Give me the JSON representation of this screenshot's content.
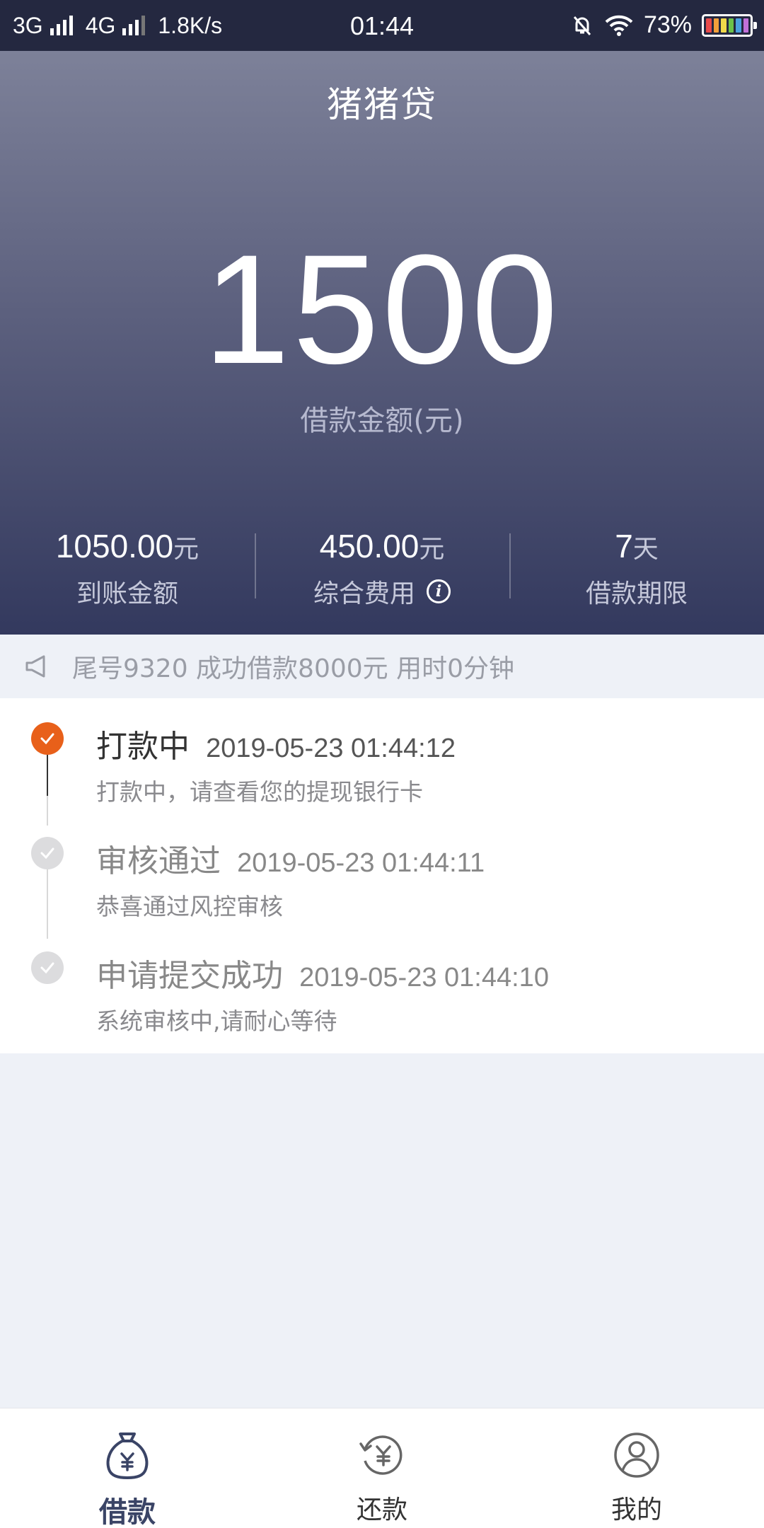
{
  "status_bar": {
    "network1": "3G",
    "network2": "4G",
    "speed": "1.8K/s",
    "time": "01:44",
    "battery": "73%",
    "icons": [
      "signal-icon",
      "mute-bell-icon",
      "wifi-icon",
      "battery-icon"
    ]
  },
  "header": {
    "app_title": "猪猪贷",
    "amount": "1500",
    "amount_label": "借款金额(元)"
  },
  "stats": [
    {
      "value": "1050.00",
      "unit": "元",
      "label": "到账金额"
    },
    {
      "value": "450.00",
      "unit": "元",
      "label": "综合费用",
      "icon": "info-icon"
    },
    {
      "value": "7",
      "unit": "天",
      "label": "借款期限"
    }
  ],
  "notice": {
    "icon": "speaker-icon",
    "text": "尾号9320 成功借款8000元 用时0分钟"
  },
  "timeline": [
    {
      "title": "打款中",
      "time": "2019-05-23 01:44:12",
      "desc": "打款中，请查看您的提现银行卡",
      "state": "active"
    },
    {
      "title": "审核通过",
      "time": "2019-05-23 01:44:11",
      "desc": "恭喜通过风控审核",
      "state": "done"
    },
    {
      "title": "申请提交成功",
      "time": "2019-05-23 01:44:10",
      "desc": "系统审核中,请耐心等待",
      "state": "done"
    }
  ],
  "bottom_nav": [
    {
      "label": "借款",
      "icon": "money-bag-icon",
      "active": true
    },
    {
      "label": "还款",
      "icon": "repay-icon",
      "active": false
    },
    {
      "label": "我的",
      "icon": "user-icon",
      "active": false
    }
  ],
  "colors": {
    "accent": "#e8601a",
    "header_top": "#7d8199",
    "header_bottom": "#33395e",
    "nav_active": "#3a4466"
  }
}
